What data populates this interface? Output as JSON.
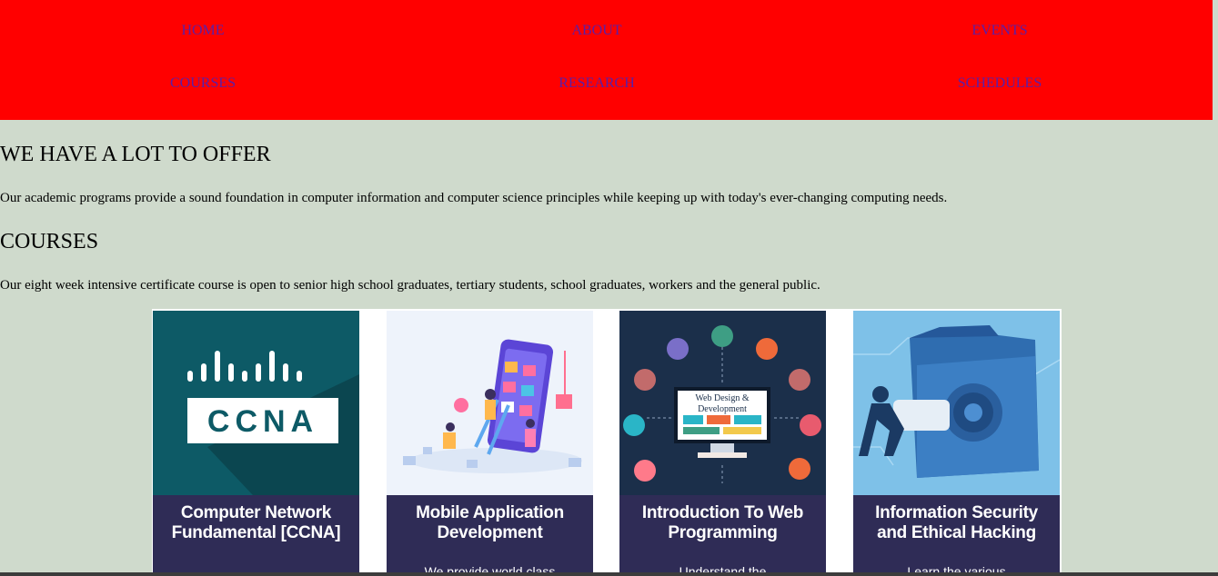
{
  "nav": {
    "items": [
      {
        "label": "HOME"
      },
      {
        "label": "ABOUT"
      },
      {
        "label": "EVENTS"
      },
      {
        "label": "COURSES"
      },
      {
        "label": "RESEARCH"
      },
      {
        "label": "SCHEDULES"
      }
    ]
  },
  "offer": {
    "heading": "WE HAVE A LOT TO OFFER",
    "text": "Our academic programs provide a sound foundation in computer information and computer science principles while keeping up with today's ever-changing computing needs."
  },
  "courses": {
    "heading": "COURSES",
    "text": "Our eight week intensive certificate course is open to senior high school graduates, tertiary students, school graduates, workers and the general public.",
    "cards": [
      {
        "title": "Computer Network Fundamental [CCNA]",
        "logo_text": "CCNA",
        "desc": "",
        "icon": "cisco-ccna-logo"
      },
      {
        "title": "Mobile Application Development",
        "desc": "We provide world class",
        "icon": "mobile-app-illustration"
      },
      {
        "title": "Introduction To Web Programming",
        "screen_text": "Web Design & Development",
        "desc": "Understand the",
        "icon": "web-design-illustration"
      },
      {
        "title": "Information Security and Ethical Hacking",
        "desc": "Learn the various",
        "icon": "security-vault-illustration"
      }
    ]
  },
  "colors": {
    "nav_bg": "#ff0000",
    "nav_link": "#5a1fa8",
    "page_bg": "#cfdacc",
    "card_band": "#2f2c56"
  }
}
